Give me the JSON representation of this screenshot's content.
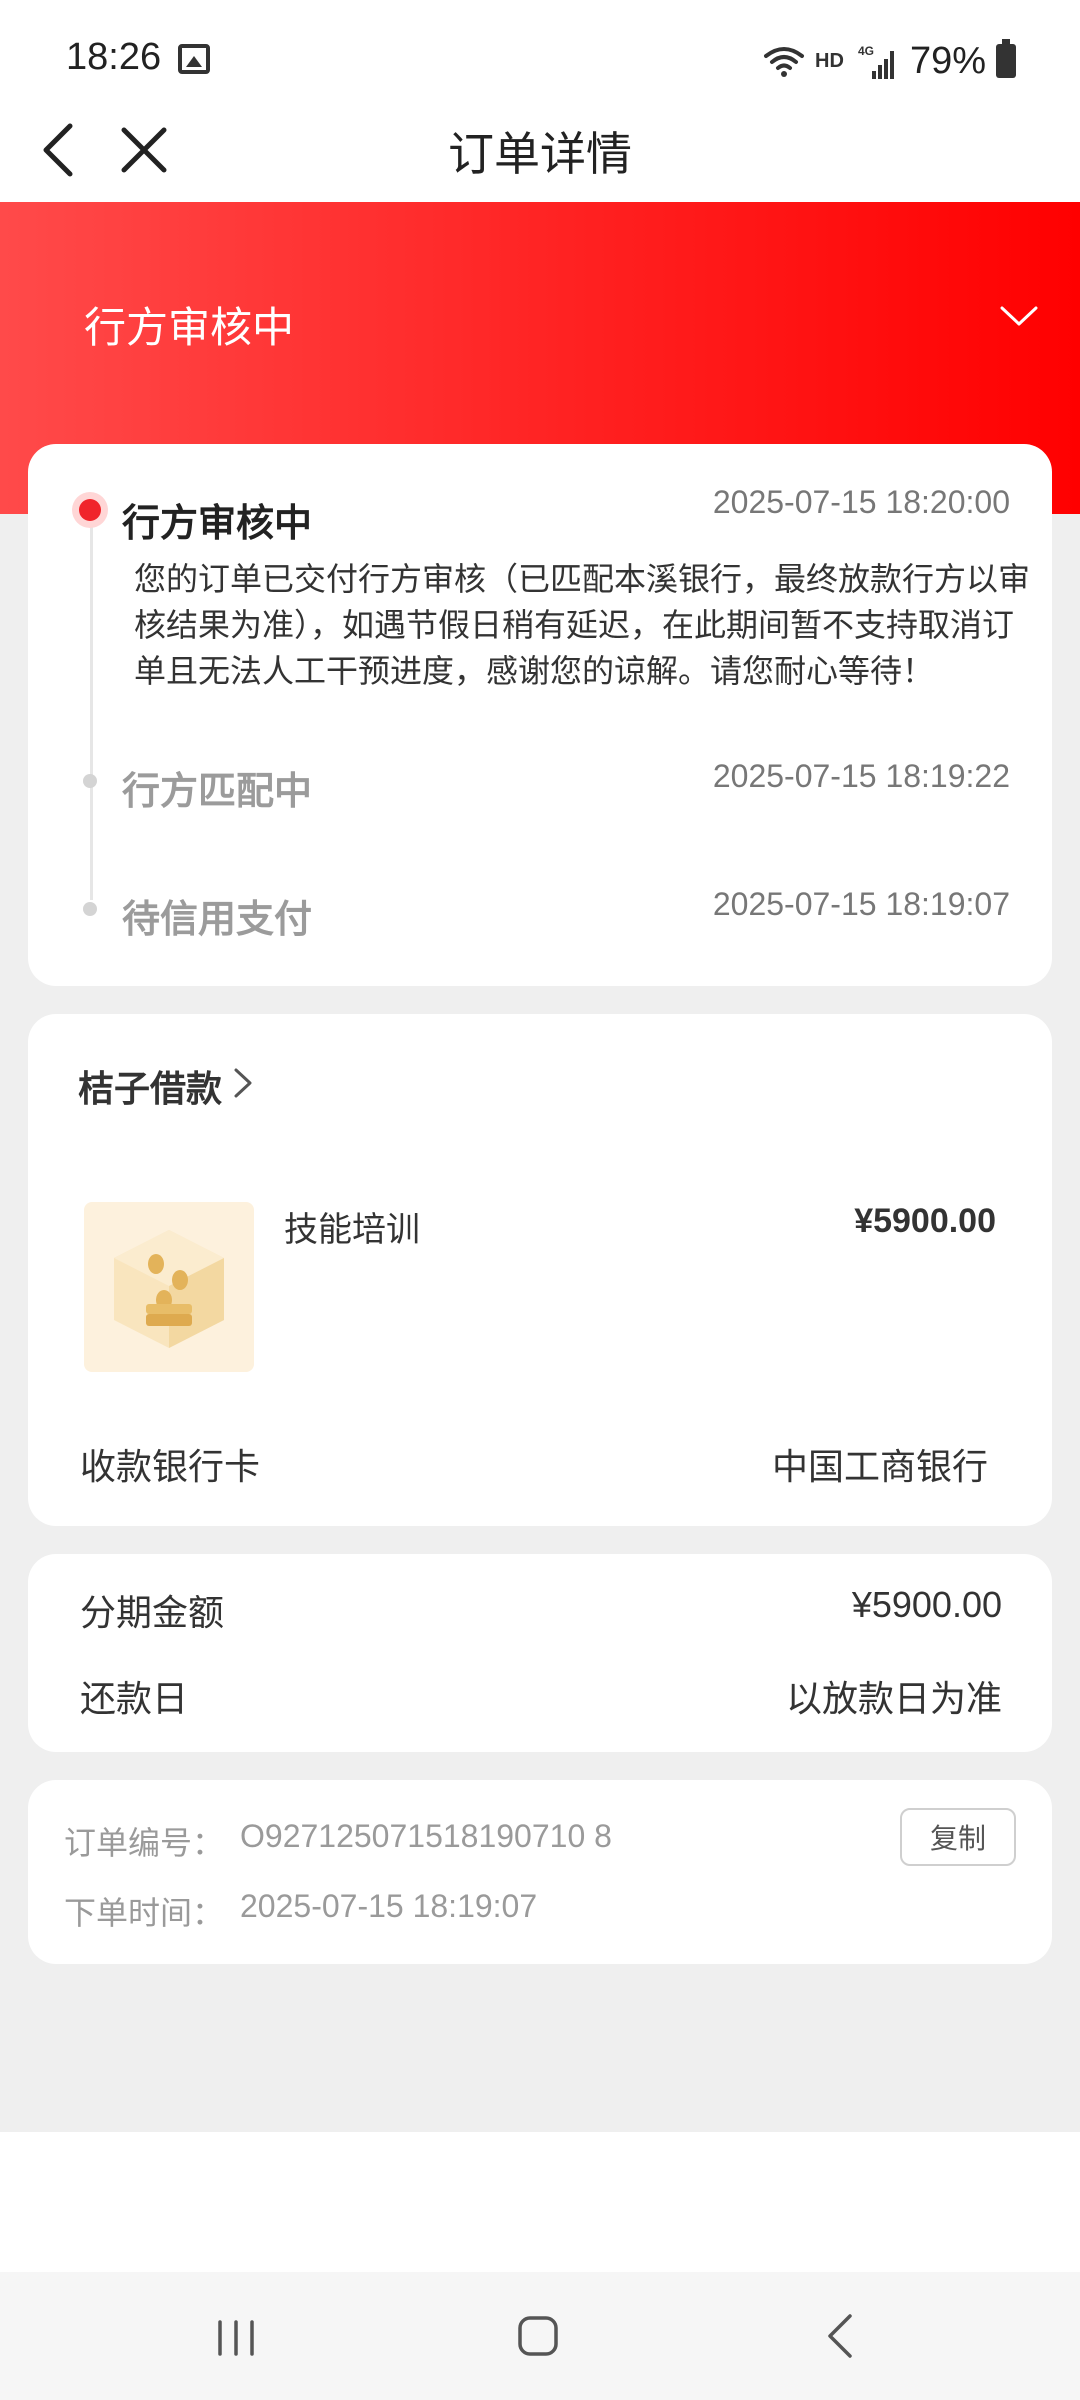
{
  "status_bar": {
    "time": "18:26",
    "network": "HD",
    "battery": "79%",
    "icons": [
      "image-icon",
      "wifi-icon",
      "signal-4g-icon",
      "battery-icon"
    ]
  },
  "nav": {
    "title": "订单详情",
    "back_icon": "chevron-left-icon",
    "close_icon": "close-icon"
  },
  "header": {
    "status": "行方审核中",
    "colors": {
      "gradient_start": "#ff4a4a",
      "gradient_end": "#ff0000"
    }
  },
  "timeline": [
    {
      "title": "行方审核中",
      "time": "2025-07-15 18:20:00",
      "description": "您的订单已交付行方审核（已匹配本溪银行，最终放款行方以审核结果为准），如遇节假日稍有延迟，在此期间暂不支持取消订单且无法人工干预进度，感谢您的谅解。请您耐心等待！",
      "active": true
    },
    {
      "title": "行方匹配中",
      "time": "2025-07-15 18:19:22",
      "active": false
    },
    {
      "title": "待信用支付",
      "time": "2025-07-15 18:19:07",
      "active": false
    }
  ],
  "product": {
    "merchant": "桔子借款",
    "name": "技能培训",
    "price": "¥5900.00",
    "bank_label": "收款银行卡",
    "bank_value": "中国工商银行"
  },
  "installment": {
    "amount_label": "分期金额",
    "amount_value": "¥5900.00",
    "repay_label": "还款日",
    "repay_value": "以放款日为准"
  },
  "order": {
    "number_label": "订单编号：",
    "number_value": "O927125071518190710 8",
    "time_label": "下单时间：",
    "time_value": "2025-07-15 18:19:07",
    "copy_label": "复制"
  }
}
